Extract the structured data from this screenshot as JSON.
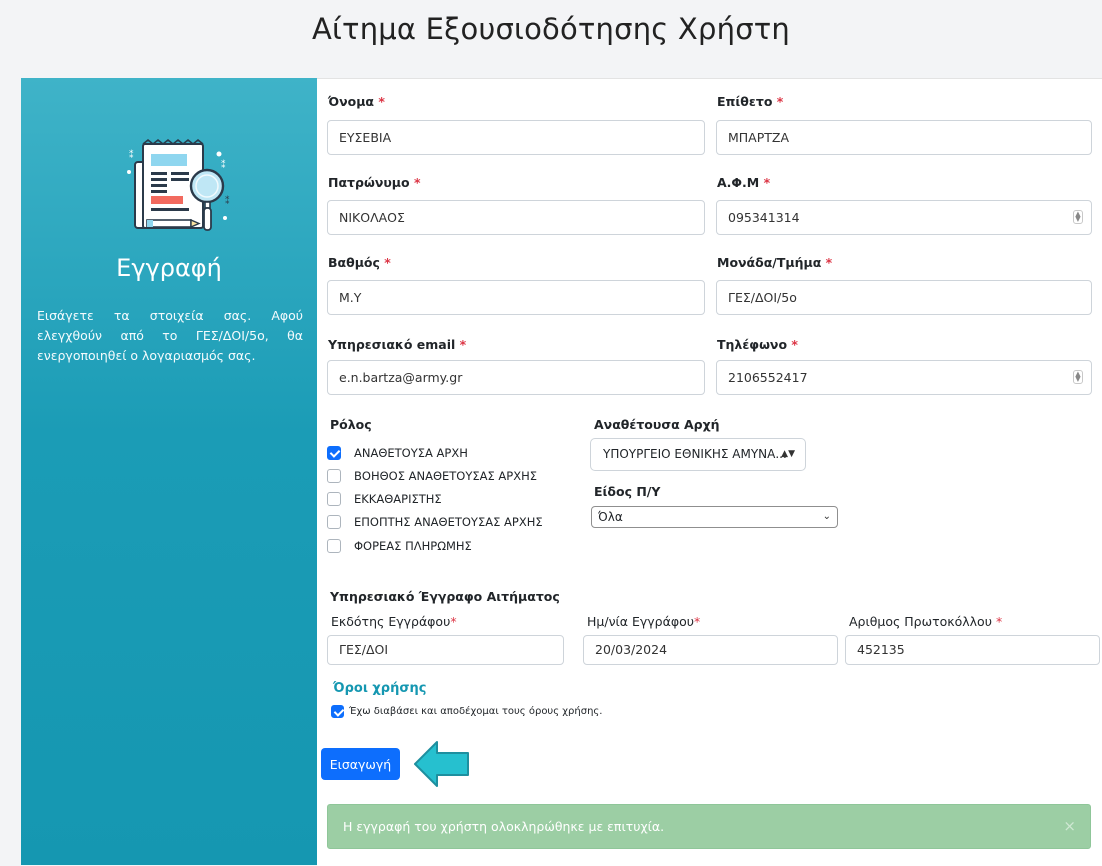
{
  "page": {
    "title": "Αίτημα Εξουσιοδότησης Χρήστη"
  },
  "sidebar": {
    "title": "Εγγραφή",
    "text": "Εισάγετε τα στοιχεία σας. Αφού ελεγχθούν από το ΓΕΣ/ΔΟΙ/5ο, θα ενεργοποιηθεί ο λογαριασμός σας."
  },
  "form": {
    "required_marker": "*",
    "first_name": {
      "label": "Όνομα",
      "value": "ΕΥΣΕΒΙΑ"
    },
    "last_name": {
      "label": "Επίθετο",
      "value": "ΜΠΑΡΤΖΑ"
    },
    "father_name": {
      "label": "Πατρώνυμο",
      "value": "ΝΙΚΟΛΑΟΣ"
    },
    "afm": {
      "label": "Α.Φ.Μ",
      "value": "095341314"
    },
    "rank": {
      "label": "Βαθμός",
      "value": "Μ.Υ"
    },
    "unit": {
      "label": "Μονάδα/Τμήμα",
      "value": "ΓΕΣ/ΔΟΙ/5ο"
    },
    "email": {
      "label": "Υπηρεσιακό email",
      "value": "e.n.bartza@army.gr"
    },
    "phone": {
      "label": "Τηλέφωνο",
      "value": "2106552417"
    },
    "roles": {
      "label": "Ρόλος",
      "items": [
        {
          "label": "ΑΝΑΘΕΤΟΥΣΑ ΑΡΧΗ",
          "checked": true
        },
        {
          "label": "ΒΟΗΘΟΣ ΑΝΑΘΕΤΟΥΣΑΣ ΑΡΧΗΣ",
          "checked": false
        },
        {
          "label": "ΕΚΚΑΘΑΡΙΣΤΗΣ",
          "checked": false
        },
        {
          "label": "ΕΠΟΠΤΗΣ ΑΝΑΘΕΤΟΥΣΑΣ ΑΡΧΗΣ",
          "checked": false
        },
        {
          "label": "ΦΟΡΕΑΣ ΠΛΗΡΩΜΗΣ",
          "checked": false
        }
      ]
    },
    "authority": {
      "label": "Αναθέτουσα Αρχή",
      "value": "ΥΠΟΥΡΓΕΙΟ ΕΘΝΙΚΗΣ ΑΜΥΝΑ..."
    },
    "budget_type": {
      "label": "Είδος Π/Υ",
      "value": "Όλα"
    },
    "document": {
      "section_label": "Υπηρεσιακό Έγγραφο Αιτήματος",
      "issuer": {
        "label": "Εκδότης Εγγράφου",
        "value": "ΓΕΣ/ΔΟΙ"
      },
      "date": {
        "label": "Ημ/νία Εγγράφου",
        "value": "20/03/2024"
      },
      "protocol": {
        "label": "Αριθμος Πρωτοκόλλου",
        "value": "452135"
      }
    },
    "terms": {
      "title": "Όροι χρήσης",
      "checkbox_label": "Έχω διαβάσει και αποδέχομαι τους όρους χρήσης.",
      "checked": true
    },
    "submit_label": "Εισαγωγή"
  },
  "alert": {
    "message": "Η εγγραφή του χρήστη ολοκληρώθηκε με επιτυχία.",
    "close": "×",
    "color": "#9ccea4"
  },
  "colors": {
    "sidebar": "#1b9cb6",
    "primary": "#0d6efd",
    "required": "#dc3545",
    "annotation_arrow": "#26c0cf"
  },
  "icons": {
    "sidebar_illustration": "document-magnifier-icon",
    "annotation": "arrow-left-icon",
    "select_caret": "up-down-caret-icon",
    "dropdown": "chevron-down-icon",
    "spinner": "number-spinner-icon"
  }
}
